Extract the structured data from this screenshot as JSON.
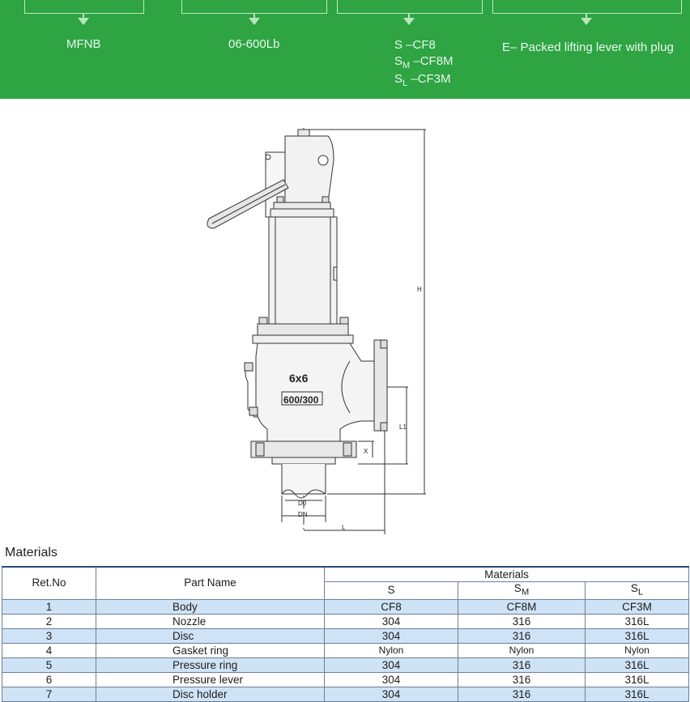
{
  "banner": {
    "model": "MFNB",
    "pressure_class": "06-600Lb",
    "material_s": "S   –CF8",
    "material_sm_prefix": "S",
    "material_sm_sub": "M",
    "material_sm_value": " –CF8M",
    "material_sl_prefix": "S",
    "material_sl_sub": "L",
    "material_sl_value": " –CF3M",
    "lever": "E– Packed lifting lever with plug"
  },
  "drawing": {
    "body_mark_size": "6x6",
    "body_mark_rating": "600/300",
    "dim_h": "H",
    "dim_l1": "L1",
    "dim_x": "X",
    "dim_d0": "D0",
    "dim_dn": "DN",
    "dim_l": "L"
  },
  "materials": {
    "title": "Materials",
    "headers": {
      "ret_no": "Ret.No",
      "part_name": "Part Name",
      "materials": "Materials",
      "s": "S",
      "sm_prefix": "S",
      "sm_sub": "M",
      "sl_prefix": "S",
      "sl_sub": "L"
    },
    "rows": [
      {
        "no": "1",
        "part": "Body",
        "s": "CF8",
        "sm": "CF8M",
        "sl": "CF3M"
      },
      {
        "no": "2",
        "part": "Nozzle",
        "s": "304",
        "sm": "316",
        "sl": "316L"
      },
      {
        "no": "3",
        "part": "Disc",
        "s": "304",
        "sm": "316",
        "sl": "316L"
      },
      {
        "no": "4",
        "part": "Gasket ring",
        "s": "Nylon",
        "sm": "Nylon",
        "sl": "Nylon"
      },
      {
        "no": "5",
        "part": "Pressure ring",
        "s": "304",
        "sm": "316",
        "sl": "316L"
      },
      {
        "no": "6",
        "part": "Pressure lever",
        "s": "304",
        "sm": "316",
        "sl": "316L"
      },
      {
        "no": "7",
        "part": "Disc holder",
        "s": "304",
        "sm": "316",
        "sl": "316L"
      }
    ]
  },
  "colors": {
    "banner_green": "#2ea443",
    "table_stripe": "#cfe3f6",
    "table_rule": "#2b4a78"
  }
}
